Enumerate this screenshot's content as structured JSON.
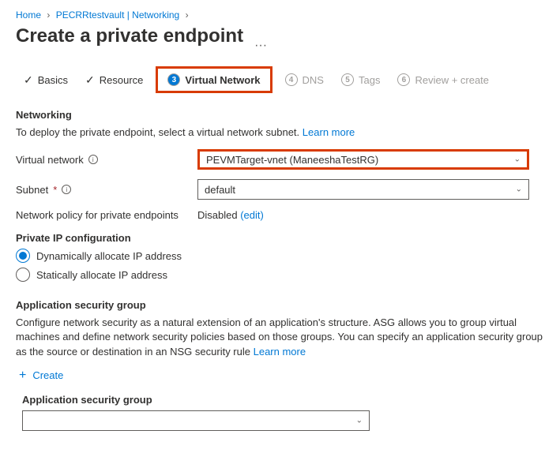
{
  "breadcrumb": {
    "home": "Home",
    "vault": "PECRRtestvault | Networking"
  },
  "page_title": "Create a private endpoint",
  "tabs": {
    "basics": "Basics",
    "resource": "Resource",
    "vnet": {
      "num": "3",
      "label": "Virtual Network"
    },
    "dns": {
      "num": "4",
      "label": "DNS"
    },
    "tags": {
      "num": "5",
      "label": "Tags"
    },
    "review": {
      "num": "6",
      "label": "Review + create"
    }
  },
  "networking": {
    "heading": "Networking",
    "desc": "To deploy the private endpoint, select a virtual network subnet.",
    "learn": "Learn more",
    "vnet_label": "Virtual network",
    "vnet_value": "PEVMTarget-vnet (ManeeshaTestRG)",
    "subnet_label": "Subnet",
    "subnet_value": "default",
    "policy_label": "Network policy for private endpoints",
    "policy_value": "Disabled",
    "policy_edit": "(edit)"
  },
  "ipconfig": {
    "heading": "Private IP configuration",
    "dynamic": "Dynamically allocate IP address",
    "static": "Statically allocate IP address"
  },
  "asg": {
    "heading": "Application security group",
    "desc": "Configure network security as a natural extension of an application's structure. ASG allows you to group virtual machines and define network security policies based on those groups. You can specify an application security group as the source or destination in an NSG security rule",
    "learn": "Learn more",
    "create": "Create",
    "sub_label": "Application security group"
  }
}
